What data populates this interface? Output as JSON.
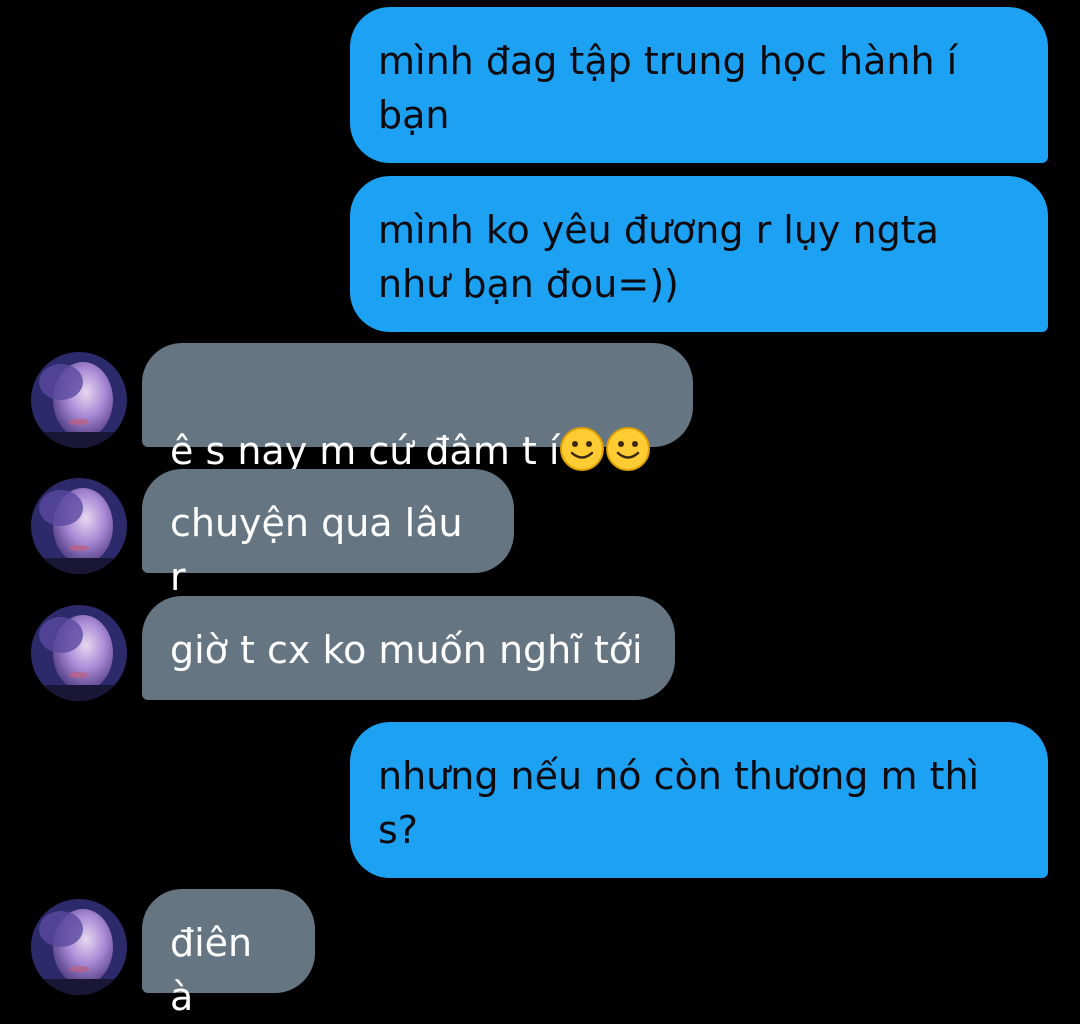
{
  "conversation": {
    "messages": [
      {
        "from": "me",
        "text": "mình đag tập trung học hành í\nbạn"
      },
      {
        "from": "me",
        "text": "mình ko yêu đương r lụy ngta\nnhư bạn đou=))"
      },
      {
        "from": "them",
        "text": "ê s nay m cứ đâm t í",
        "emoji": [
          "slightly-smiling-face-icon",
          "slightly-smiling-face-icon"
        ]
      },
      {
        "from": "them",
        "text": "chuyện qua lâu r"
      },
      {
        "from": "them",
        "text": "giờ t cx ko muốn nghĩ tới"
      },
      {
        "from": "me",
        "text": "nhưng nếu nó còn thương m thì\ns?"
      },
      {
        "from": "them",
        "text": "điên à"
      }
    ]
  },
  "theme": {
    "background": "#000000",
    "sent_bubble": "#1DA1F2",
    "received_bubble": "#667582"
  }
}
